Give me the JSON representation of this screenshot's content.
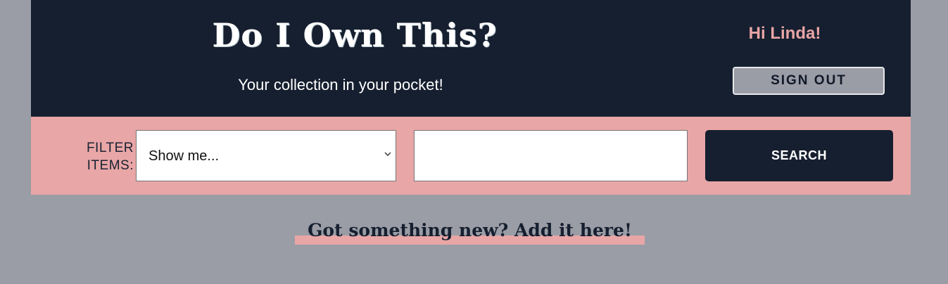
{
  "header": {
    "title": "Do I Own This?",
    "tagline": "Your collection in your pocket!",
    "greeting": "Hi Linda!",
    "signout_label": "SIGN OUT"
  },
  "filter": {
    "label": "FILTER ITEMS:",
    "select": {
      "selected": "Show me...",
      "icon": "chevron-down-icon"
    },
    "search": {
      "value": "",
      "placeholder": ""
    },
    "search_label": "SEARCH"
  },
  "add": {
    "heading": "Got something new? Add it here!"
  },
  "colors": {
    "navy": "#161f2f",
    "pink": "#e8a6a6",
    "gray_background": "#9a9da6",
    "white": "#ffffff"
  }
}
